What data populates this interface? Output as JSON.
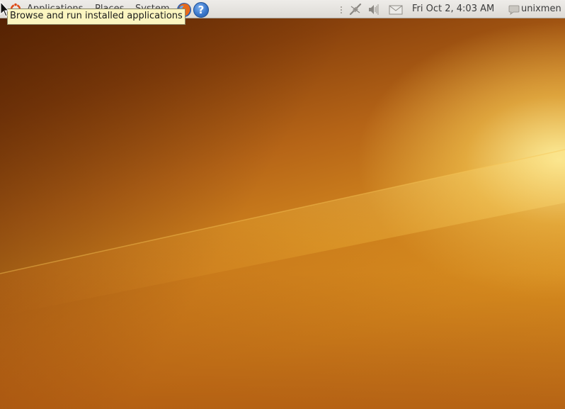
{
  "top_panel": {
    "menus": [
      {
        "label": "Applications"
      },
      {
        "label": "Places"
      },
      {
        "label": "System"
      }
    ],
    "launchers": [
      {
        "icon": "firefox-icon"
      },
      {
        "icon": "help-icon",
        "glyph": "?"
      }
    ],
    "tray": {
      "icons": [
        "network-disconnected-icon",
        "volume-icon",
        "mail-icon"
      ],
      "clock": "Fri Oct  2,  4:03 AM",
      "user": "unixmen",
      "user_icon": "chat-bubble-icon"
    }
  },
  "tooltip": {
    "text": "Browse and run installed applications"
  },
  "colors": {
    "panel": "#e6e3df",
    "tooltip_bg": "#fbf5c0",
    "wallpaper_light": "#f6d35a",
    "wallpaper_dark": "#6a2e05"
  }
}
